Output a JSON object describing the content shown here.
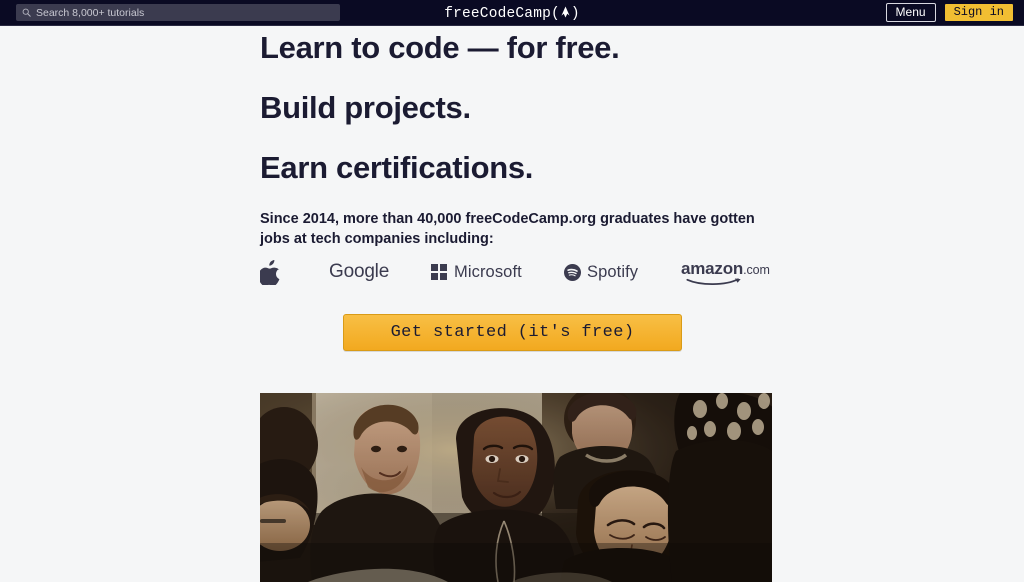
{
  "header": {
    "search": {
      "icon": "search-icon",
      "placeholder": "Search 8,000+ tutorials",
      "value": ""
    },
    "brand": {
      "text_before": "freeCodeCamp(",
      "flame_icon": "flame-icon",
      "text_after": ")",
      "full_text": "freeCodeCamp(▲)"
    },
    "menu_label": "Menu",
    "signin_label": "Sign in",
    "colors": {
      "bar_background": "#0a0a23",
      "search_background": "#3b3b4f",
      "signin_background": "#f1be32",
      "menu_border": "#d8d8e0"
    }
  },
  "hero": {
    "line1": "Learn to code — for free.",
    "line2": "Build projects.",
    "line3": "Earn certifications.",
    "blurb": "Since 2014, more than 40,000 freeCodeCamp.org graduates have gotten jobs at tech companies including:",
    "cta_label": "Get started (it's free)",
    "cta_color": "#f5ad2b",
    "heading_color": "#1b1b32"
  },
  "companies": [
    {
      "name": "Apple",
      "label": "",
      "icon": "apple-logo-icon"
    },
    {
      "name": "Google",
      "label": "Google",
      "icon": ""
    },
    {
      "name": "Microsoft",
      "label": "Microsoft",
      "icon": "microsoft-squares-icon"
    },
    {
      "name": "Spotify",
      "label": "Spotify",
      "icon": "spotify-logo-icon"
    },
    {
      "name": "Amazon",
      "label": "amazon",
      "tld": ".com",
      "icon": "amazon-smile-icon"
    }
  ],
  "photo": {
    "alt": "Group of people collaborating around a laptop",
    "caption": ""
  }
}
